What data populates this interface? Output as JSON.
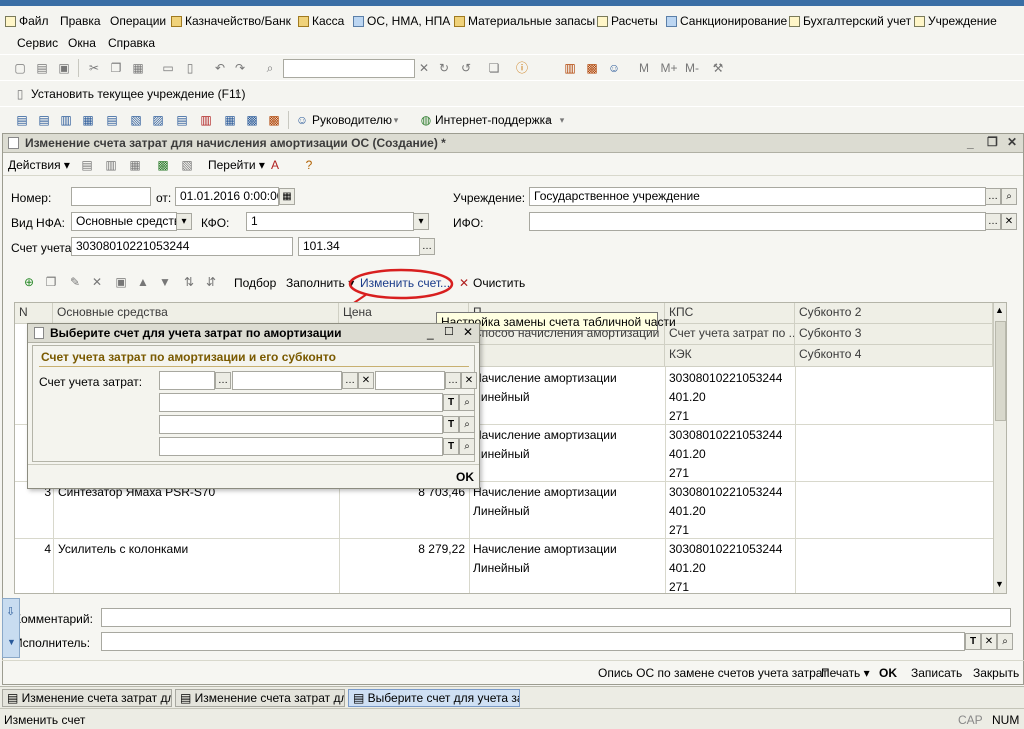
{
  "menu": {
    "row1": [
      "Файл",
      "Правка",
      "Операции",
      "Казначейство/Банк",
      "Касса",
      "ОС, НМА, НПА",
      "Материальные запасы",
      "Расчеты",
      "Санкционирование",
      "Бухгалтерский учет",
      "Учреждение"
    ],
    "row2": [
      "Сервис",
      "Окна",
      "Справка"
    ]
  },
  "toolbar2": {
    "set_institution": "Установить текущее учреждение (F11)"
  },
  "toolbar3": {
    "manager": "Руководителю",
    "internet_support": "Интернет-поддержка"
  },
  "doc": {
    "title": "Изменение счета затрат для начисления амортизации ОС (Создание) *",
    "actions_label": "Действия",
    "goto_label": "Перейти",
    "labels": {
      "number": "Номер:",
      "from": "от:",
      "institution": "Учреждение:",
      "nfa_type": "Вид НФА:",
      "kfo": "КФО:",
      "ifo": "ИФО:",
      "account": "Счет учета:",
      "comment": "Комментарий:",
      "executor": "Исполнитель:"
    },
    "values": {
      "number": "",
      "date": "01.01.2016 0:00:00",
      "institution": "Государственное учреждение",
      "nfa_type": "Основные средства",
      "kfo": "1",
      "ifo": "",
      "account": "30308010221053244",
      "account2": "101.34",
      "comment": "",
      "executor": ""
    },
    "table_toolbar": {
      "select": "Подбор",
      "fill": "Заполнить",
      "change_account": "Изменить счет...",
      "clear": "Очистить"
    },
    "grid": {
      "headers": {
        "n": "N",
        "assets": "Основные средства",
        "price": "Цена",
        "method_top": "П...",
        "method": "Способ начисления амортизации",
        "kps": "КПС",
        "kps2": "Счет учета затрат по ...",
        "kek": "КЭК",
        "sub2": "Субконто 2",
        "sub3": "Субконто 3",
        "sub4": "Субконто 4"
      },
      "rows": [
        {
          "n": "",
          "name": "",
          "price": "",
          "method": "Начисление амортизации",
          "method2": "Линейный",
          "kps": "30308010221053244",
          "acc": "401.20",
          "kek": "271"
        },
        {
          "n": "",
          "name": "",
          "price": "",
          "method": "Начисление амортизации",
          "method2": "Линейный",
          "kps": "30308010221053244",
          "acc": "401.20",
          "kek": "271"
        },
        {
          "n": "3",
          "name": "Синтезатор Ямаха PSR-S70",
          "price": "8 703,46",
          "method": "Начисление амортизации",
          "method2": "Линейный",
          "kps": "30308010221053244",
          "acc": "401.20",
          "kek": "271"
        },
        {
          "n": "4",
          "name": "Усилитель с колонками",
          "price": "8 279,22",
          "method": "Начисление амортизации",
          "method2": "Линейный",
          "kps": "30308010221053244",
          "acc": "401.20",
          "kek": "271"
        }
      ]
    },
    "tooltip": "Настройка замены счета табличной части",
    "bottom": {
      "inventory": "Опись ОС по замене счетов учета затрат",
      "print": "Печать",
      "ok": "OK",
      "save": "Записать",
      "close": "Закрыть"
    }
  },
  "dialog": {
    "title": "Выберите счет для учета затрат по амортизации",
    "group_title": "Счет учета затрат по амортизации и его субконто",
    "label": "Счет учета затрат:",
    "ok": "OK"
  },
  "tabs": [
    "Изменение счета затрат дл...",
    "Изменение счета затрат дл...",
    "Выберите счет для учета за..."
  ],
  "status": {
    "text": "Изменить счет",
    "cap": "CAP",
    "num": "NUM"
  },
  "colors": {
    "accent_red": "#d81f1f",
    "window_bg": "#f4f4f0",
    "dialog_group_title": "#7a5a00"
  }
}
